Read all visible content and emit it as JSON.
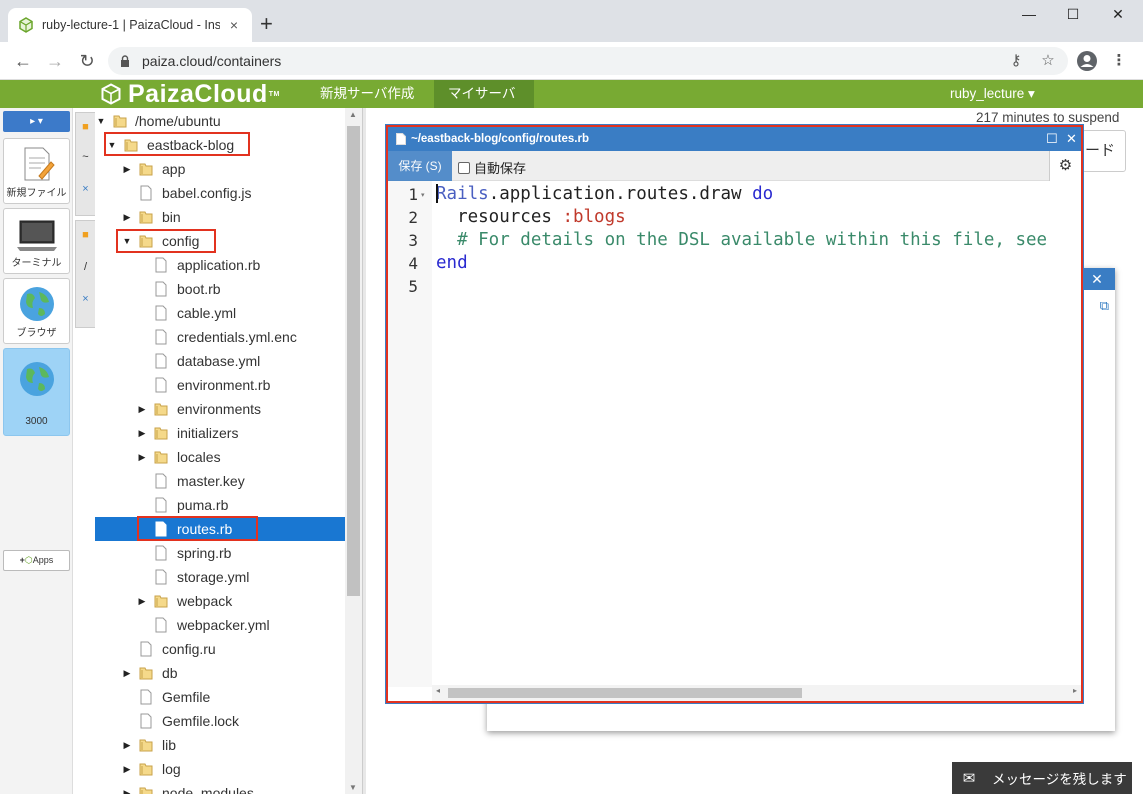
{
  "browser": {
    "tab_title": "ruby-lecture-1 | PaizaCloud - Inst",
    "tab_close": "×",
    "new_tab": "+",
    "minimize": "—",
    "maximize": "☐",
    "close": "✕",
    "url": "paiza.cloud/containers"
  },
  "header": {
    "logo": "PaizaCloud",
    "logo_tm": "TM",
    "nav_new_server": "新規サーバ作成",
    "nav_my_server": "マイサーバ",
    "user": "ruby_lecture ▾"
  },
  "launcher": {
    "new_file": "新規ファイル",
    "terminal": "ターミナル",
    "browser": "ブラウザ",
    "port": "3000",
    "apps": "Apps"
  },
  "tree": {
    "root": "/home/ubuntu",
    "items": [
      {
        "label": "eastback-blog"
      },
      {
        "label": "app"
      },
      {
        "label": "babel.config.js"
      },
      {
        "label": "bin"
      },
      {
        "label": "config"
      },
      {
        "label": "application.rb"
      },
      {
        "label": "boot.rb"
      },
      {
        "label": "cable.yml"
      },
      {
        "label": "credentials.yml.enc"
      },
      {
        "label": "database.yml"
      },
      {
        "label": "environment.rb"
      },
      {
        "label": "environments"
      },
      {
        "label": "initializers"
      },
      {
        "label": "locales"
      },
      {
        "label": "master.key"
      },
      {
        "label": "puma.rb"
      },
      {
        "label": "routes.rb"
      },
      {
        "label": "spring.rb"
      },
      {
        "label": "storage.yml"
      },
      {
        "label": "webpack"
      },
      {
        "label": "webpacker.yml"
      },
      {
        "label": "config.ru"
      },
      {
        "label": "db"
      },
      {
        "label": "Gemfile"
      },
      {
        "label": "Gemfile.lock"
      },
      {
        "label": "lib"
      },
      {
        "label": "log"
      },
      {
        "label": "node_modules"
      }
    ]
  },
  "status": {
    "suspend": "217 minutes to suspend",
    "bg_button": "ード"
  },
  "editor": {
    "title": "~/eastback-blog/config/routes.rb",
    "save": "保存 (S)",
    "autosave": "自動保存",
    "lines": [
      "1",
      "2",
      "3",
      "4",
      "5"
    ],
    "code": [
      {
        "a": "Rails",
        "b": ".application.routes.draw ",
        "c": "do"
      },
      {
        "a": "  resources ",
        "b": ":blogs"
      },
      {
        "a": "  # For details on the DSL available within this file, see"
      },
      {
        "a": "end"
      }
    ]
  },
  "message": "メッセージを残します",
  "colors": {
    "paiza_green": "#78aa33",
    "editor_blue": "#3a7dc4",
    "highlight_red": "#e2321f",
    "selection_blue": "#1977d2"
  }
}
